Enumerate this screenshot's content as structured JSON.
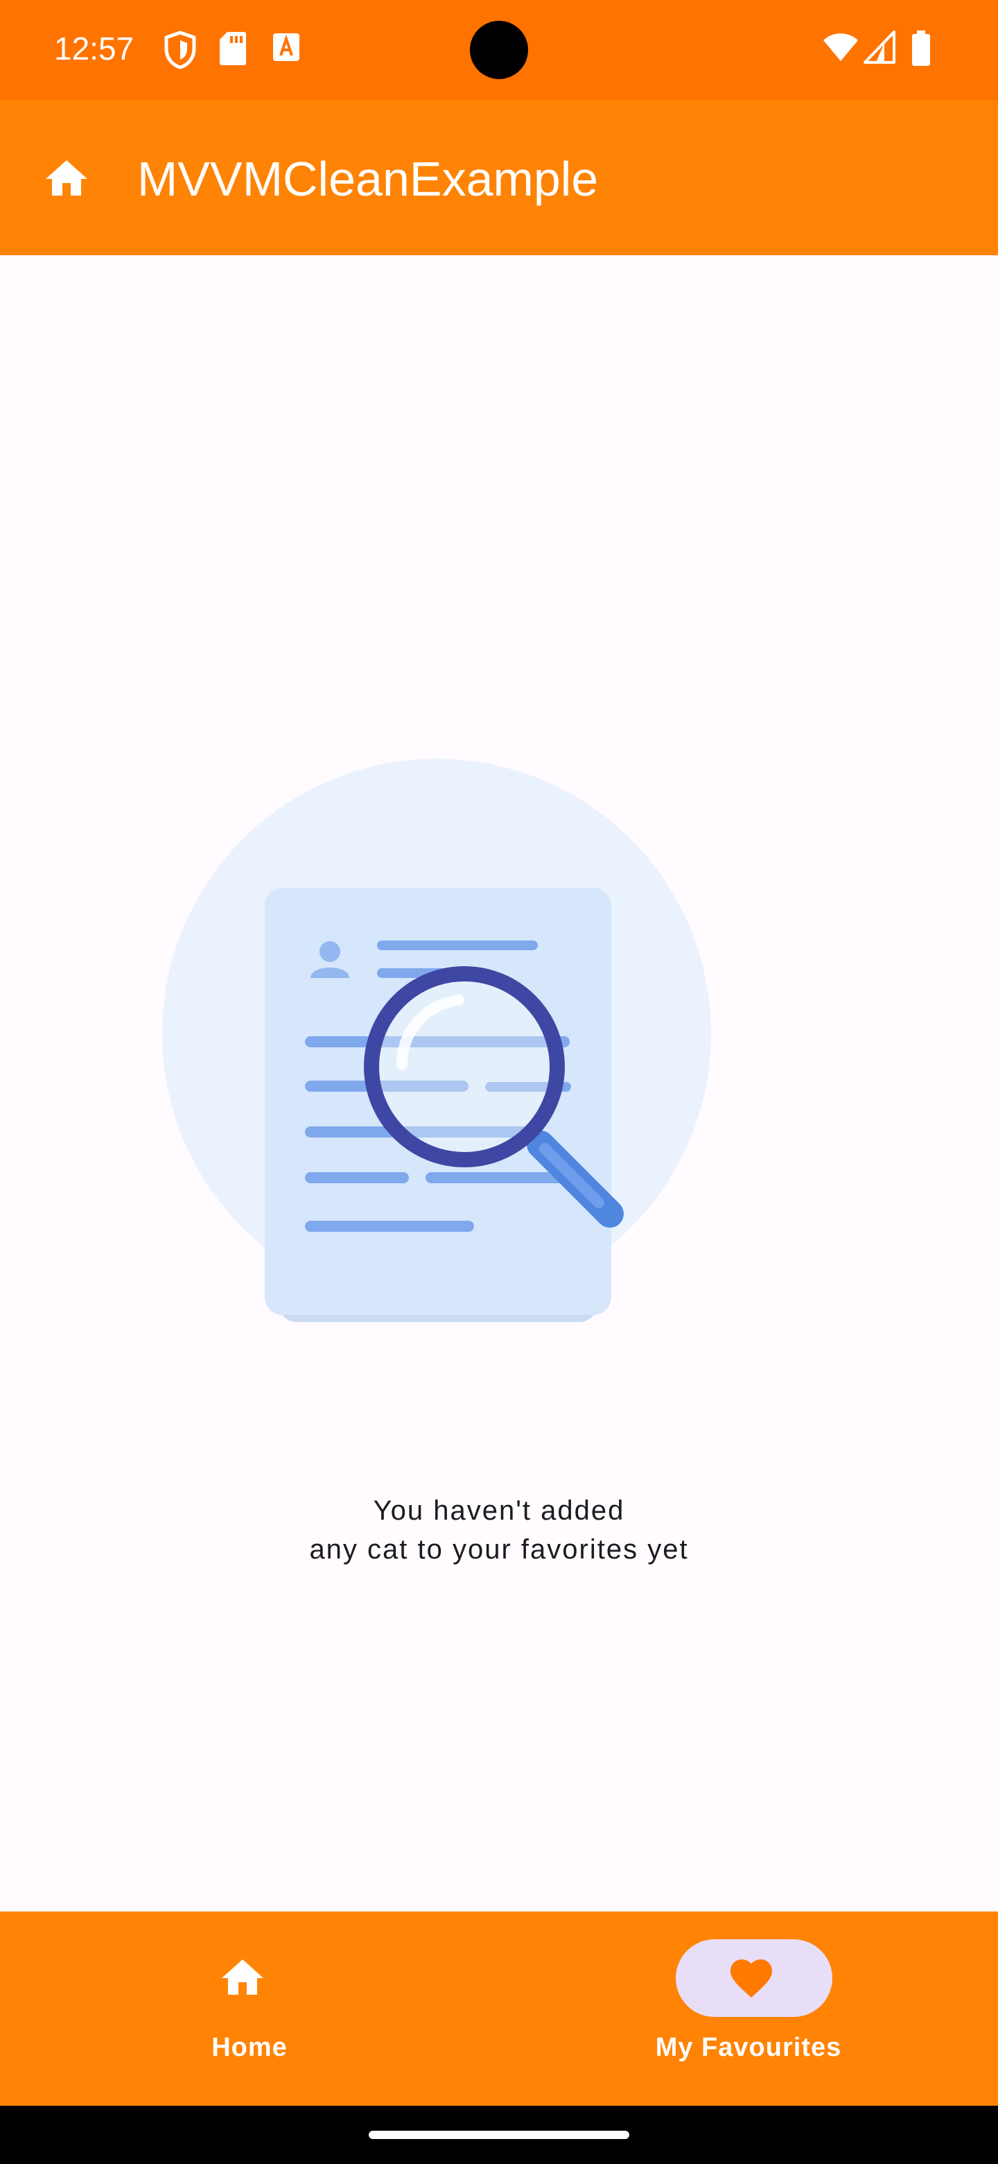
{
  "status_bar": {
    "time": "12:57",
    "left_icons": [
      "shield-icon",
      "sd-card-icon",
      "font-a-icon"
    ],
    "right_icons": [
      "wifi-icon",
      "signal-icon",
      "battery-icon"
    ],
    "background": "#FF7300"
  },
  "app_bar": {
    "title": "MVVMCleanExample",
    "icon": "home-icon",
    "background": "#FF8304"
  },
  "empty_state": {
    "illustration": "document-search-illustration",
    "line1": "You haven't added",
    "line2": "any cat to your favorites yet"
  },
  "bottom_nav": {
    "background": "#FF8304",
    "items": [
      {
        "label": "Home",
        "icon": "home-icon",
        "selected": false
      },
      {
        "label": "My Favourites",
        "icon": "heart-icon",
        "selected": true
      }
    ],
    "active_indicator_color": "#E8DEF8",
    "active_icon_color": "#FF7A00"
  }
}
